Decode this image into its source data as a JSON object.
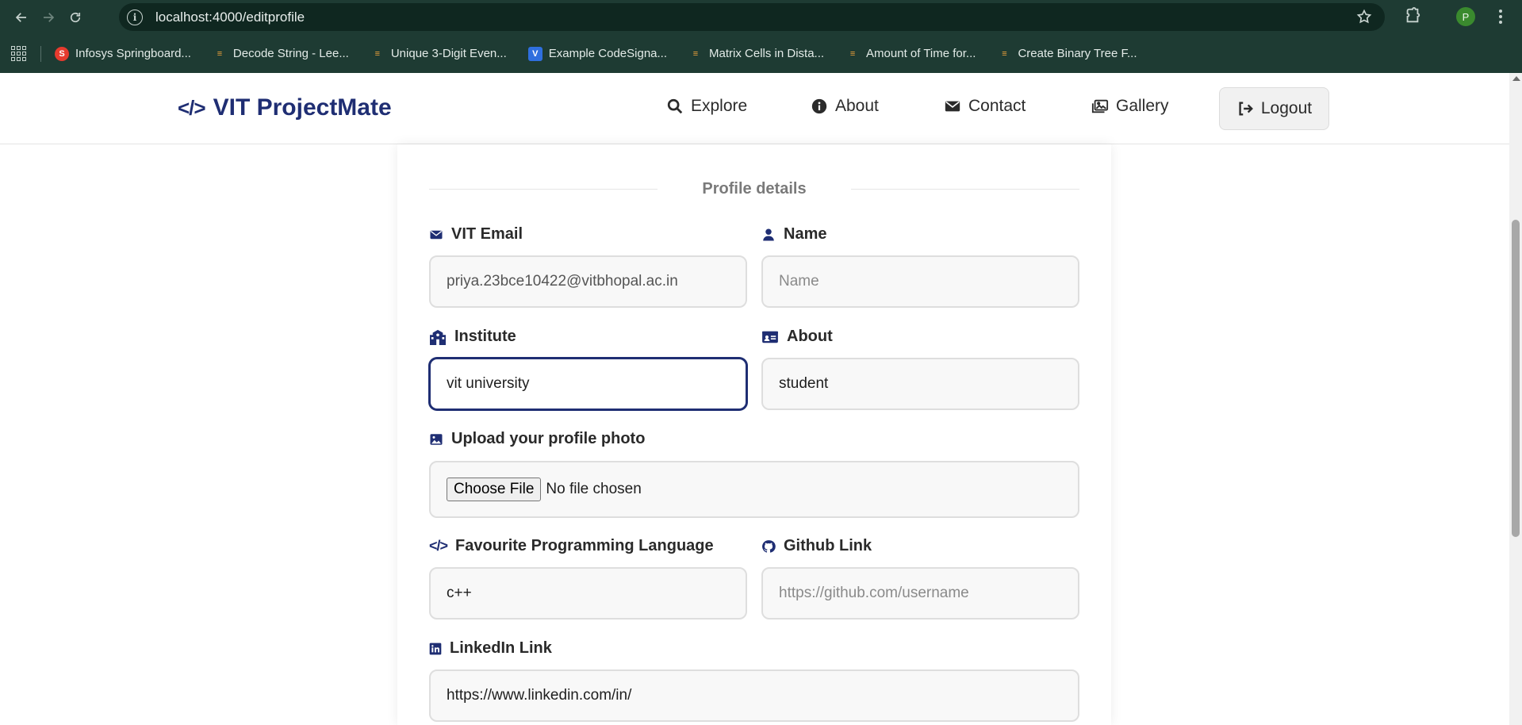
{
  "browser": {
    "url": "localhost:4000/editprofile",
    "avatar_letter": "P",
    "bookmarks": [
      {
        "label": "Infosys Springboard..."
      },
      {
        "label": "Decode String - Lee..."
      },
      {
        "label": "Unique 3-Digit Even..."
      },
      {
        "label": "Example CodeSigna..."
      },
      {
        "label": "Matrix Cells in Dista..."
      },
      {
        "label": "Amount of Time for..."
      },
      {
        "label": "Create Binary Tree F..."
      }
    ]
  },
  "nav": {
    "brand": "VIT ProjectMate",
    "explore": "Explore",
    "about": "About",
    "contact": "Contact",
    "gallery": "Gallery",
    "logout": "Logout"
  },
  "form": {
    "section_title": "Profile details",
    "email": {
      "label": "VIT Email",
      "value": "priya.23bce10422@vitbhopal.ac.in"
    },
    "name": {
      "label": "Name",
      "placeholder": "Name",
      "value": ""
    },
    "institute": {
      "label": "Institute",
      "value": "vit university"
    },
    "about": {
      "label": "About",
      "value": "student"
    },
    "photo": {
      "label": "Upload your profile photo",
      "button": "Choose File",
      "status": "No file chosen"
    },
    "language": {
      "label": "Favourite Programming Language",
      "value": "c++"
    },
    "github": {
      "label": "Github Link",
      "placeholder": "https://github.com/username",
      "value": ""
    },
    "linkedin": {
      "label": "LinkedIn Link",
      "value": "https://www.linkedin.com/in/"
    }
  },
  "colors": {
    "accent": "#1f2e73",
    "chrome": "#1e3b33"
  }
}
